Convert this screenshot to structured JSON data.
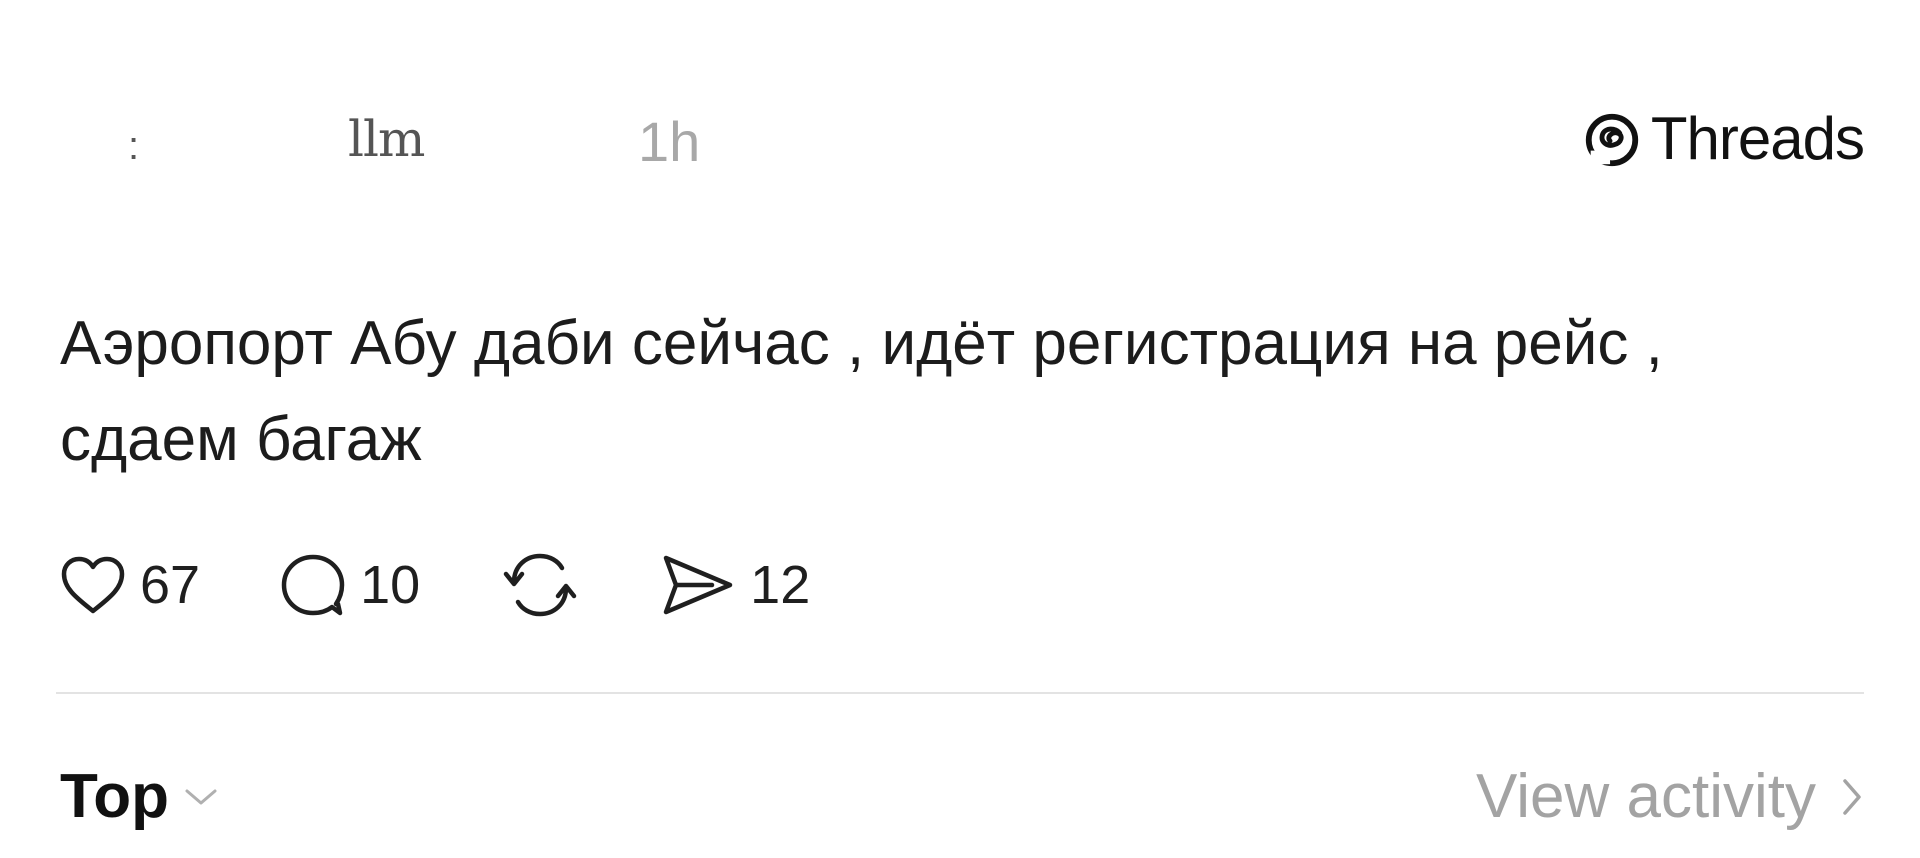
{
  "header": {
    "user_marker": ":",
    "username": "llm",
    "time": "1h",
    "brand": "Threads"
  },
  "post": {
    "text": "Аэропорт Абу даби сейчас , идёт регистрация на рейс , сдаем багаж"
  },
  "actions": {
    "likes": "67",
    "replies": "10",
    "shares": "12"
  },
  "footer": {
    "sort_label": "Top",
    "activity_label": "View activity"
  },
  "icons": {
    "brand": "threads-logo-icon",
    "like": "heart-icon",
    "reply": "comment-icon",
    "repost": "repost-icon",
    "share": "send-icon",
    "sort": "chevron-down-icon",
    "activity": "chevron-right-icon"
  },
  "colors": {
    "text": "#1c1c1c",
    "muted": "#a8a8a8",
    "divider": "#e3e3e3"
  }
}
